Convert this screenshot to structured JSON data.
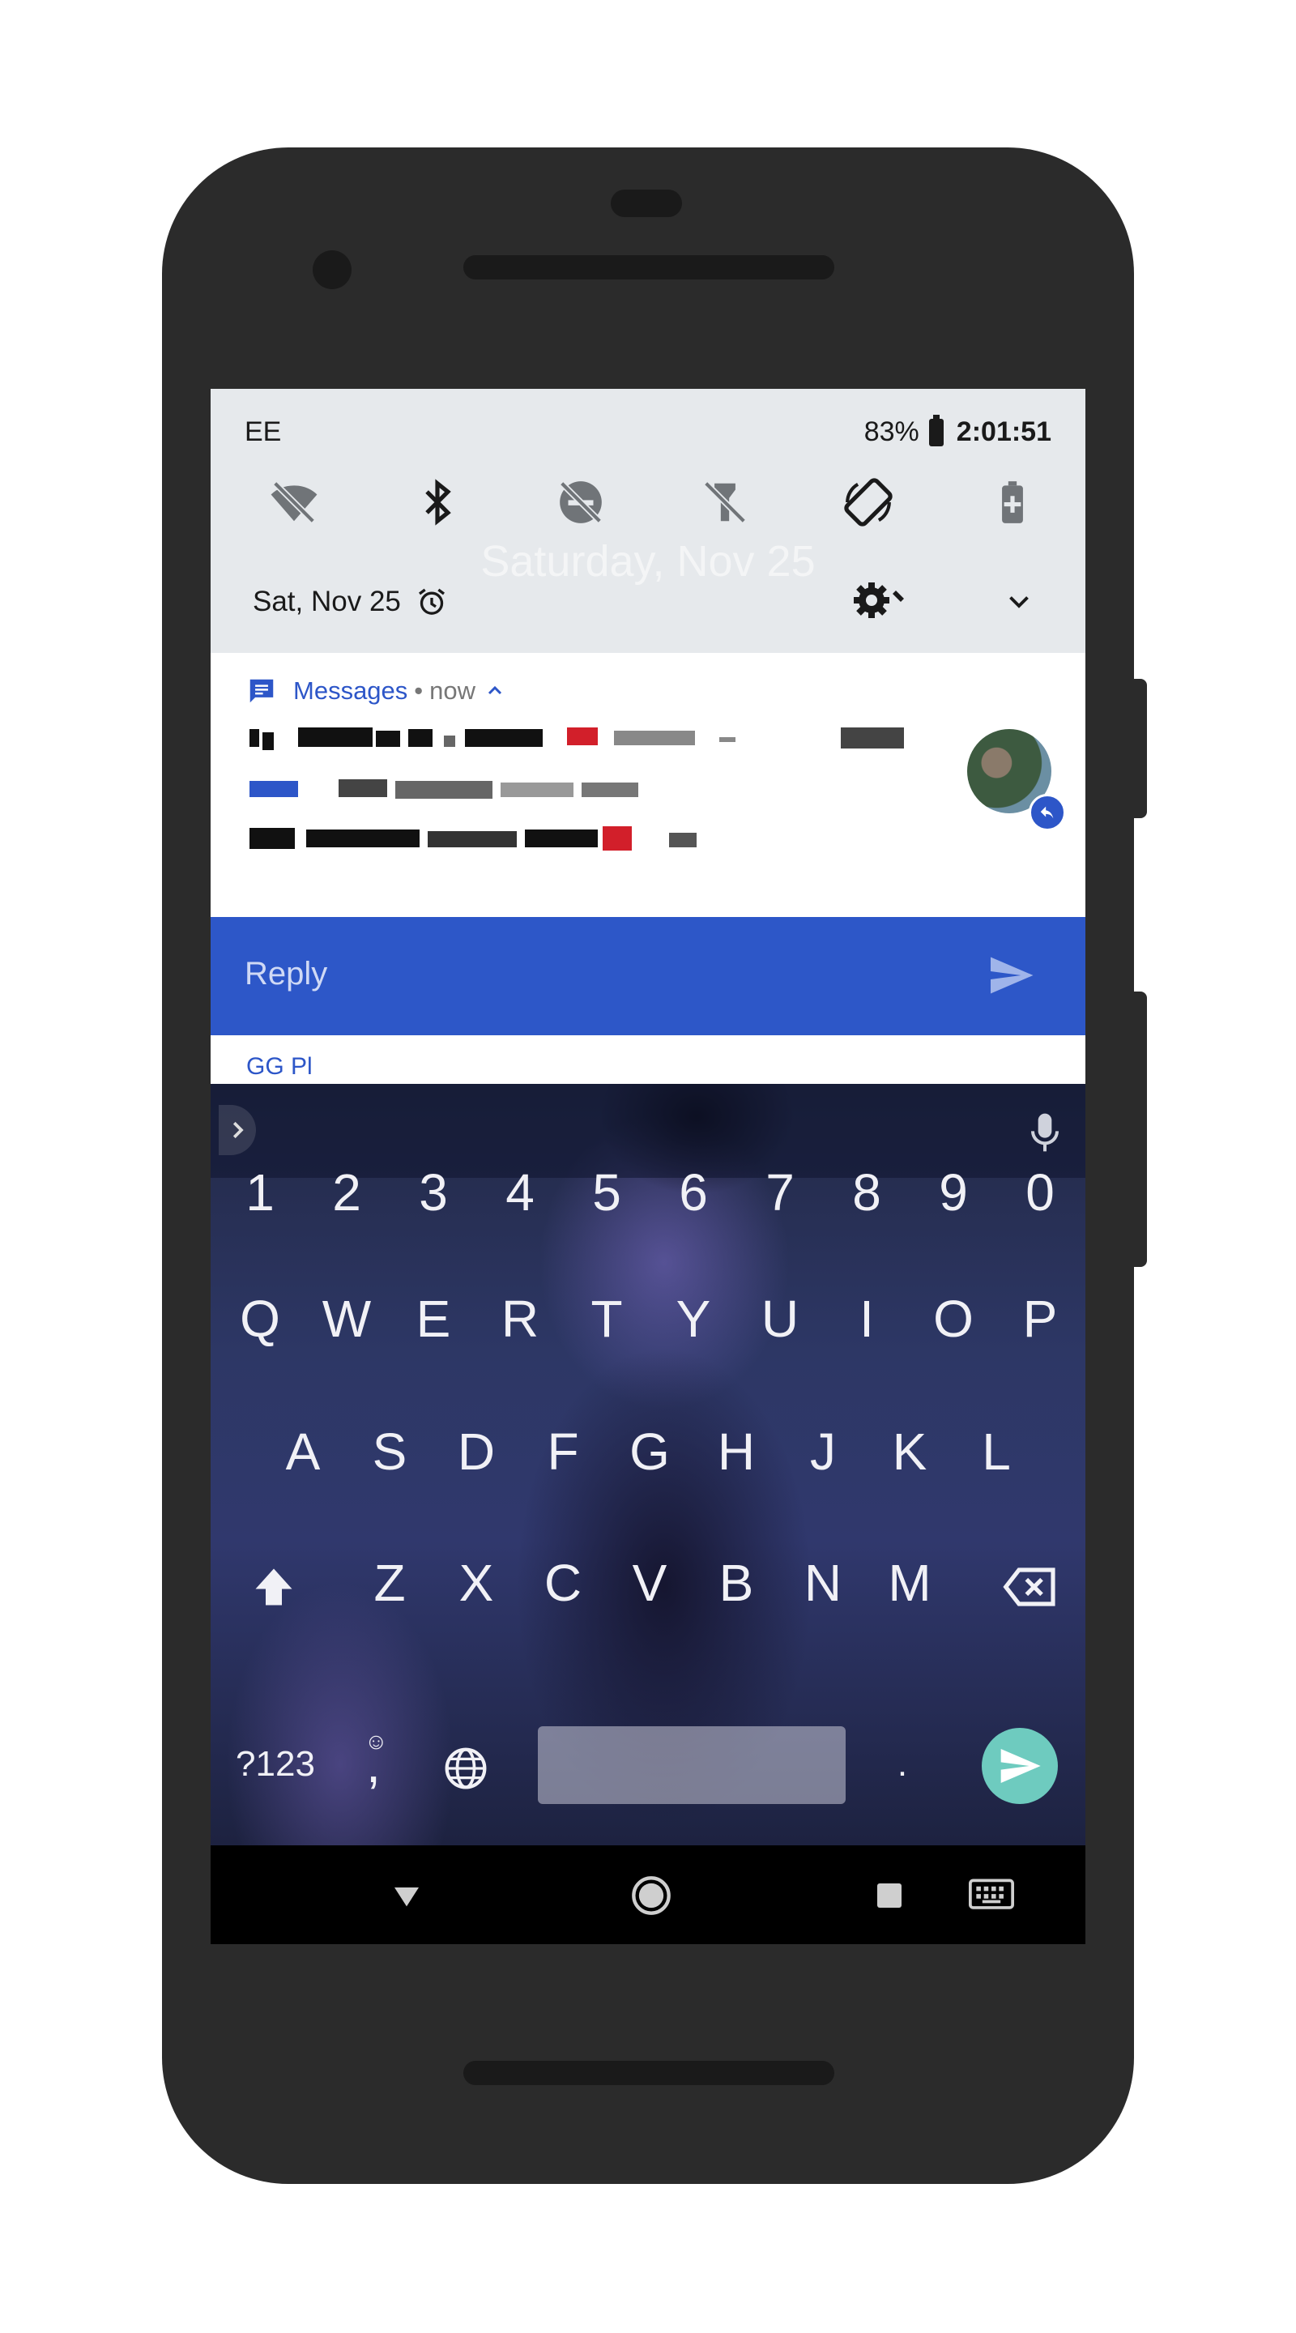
{
  "status_bar": {
    "carrier": "EE",
    "battery": "83%",
    "time": "2:01:51"
  },
  "quick_settings": {
    "tiles": [
      "wifi-off-icon",
      "bluetooth-icon",
      "do-not-disturb-off-icon",
      "flashlight-off-icon",
      "auto-rotate-icon",
      "battery-saver-icon"
    ],
    "ghost_date": "Saturday, Nov 25",
    "date": "Sat, Nov 25"
  },
  "notification": {
    "app_name": "Messages",
    "separator": "•",
    "time": "now",
    "reply_label": "Reply",
    "peek_label": "GG Pl"
  },
  "keyboard": {
    "number_row": [
      "1",
      "2",
      "3",
      "4",
      "5",
      "6",
      "7",
      "8",
      "9",
      "0"
    ],
    "row1": [
      "Q",
      "W",
      "E",
      "R",
      "T",
      "Y",
      "U",
      "I",
      "O",
      "P"
    ],
    "row2": [
      "A",
      "S",
      "D",
      "F",
      "G",
      "H",
      "J",
      "K",
      "L"
    ],
    "row3": [
      "Z",
      "X",
      "C",
      "V",
      "B",
      "N",
      "M"
    ],
    "symbols_key": "?123",
    "comma_key": ",",
    "period_key": "."
  },
  "colors": {
    "accent": "#2d57c8",
    "enter_key": "#6ecbbf",
    "qs_background": "#e6e9ec"
  }
}
